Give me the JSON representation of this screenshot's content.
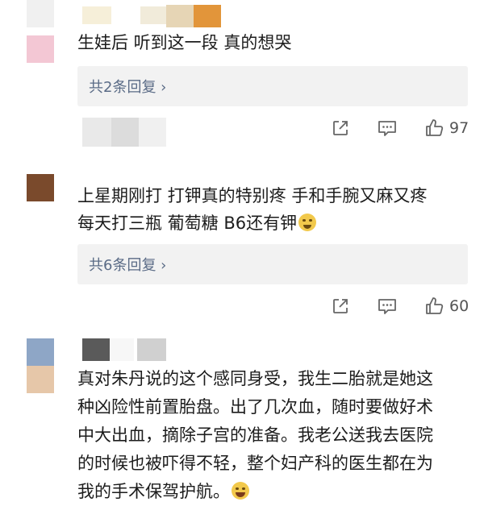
{
  "comments": [
    {
      "text_lines": [
        "生娃后 听到这一段 真的想哭"
      ],
      "reply_label": "共2条回复 ›",
      "like_count": "97"
    },
    {
      "text_lines": [
        "上星期刚打 打钾真的特别疼 手和手腕又麻又疼",
        "每天打三瓶  葡萄糖 B6还有钾"
      ],
      "reply_label": "共6条回复 ›",
      "like_count": "60"
    },
    {
      "text_lines": [
        "真对朱丹说的这个感同身受，我生二胎就是她这",
        "种凶险性前置胎盘。出了几次血，随时要做好术",
        "中大出血，摘除子宫的准备。我老公送我去医院",
        "的时候也被吓得不轻，整个妇产科的医生都在为",
        "我的手术保驾护航。"
      ]
    }
  ],
  "icons": {
    "share": "share-icon",
    "comment": "comment-icon",
    "like": "thumbs-up-icon",
    "crying_emoji": "crying-emoji-icon",
    "laughing_emoji": "laugh-cry-emoji-icon"
  },
  "colors": {
    "reply_link": "#5a6b86",
    "reply_bg": "#f2f2f2"
  }
}
